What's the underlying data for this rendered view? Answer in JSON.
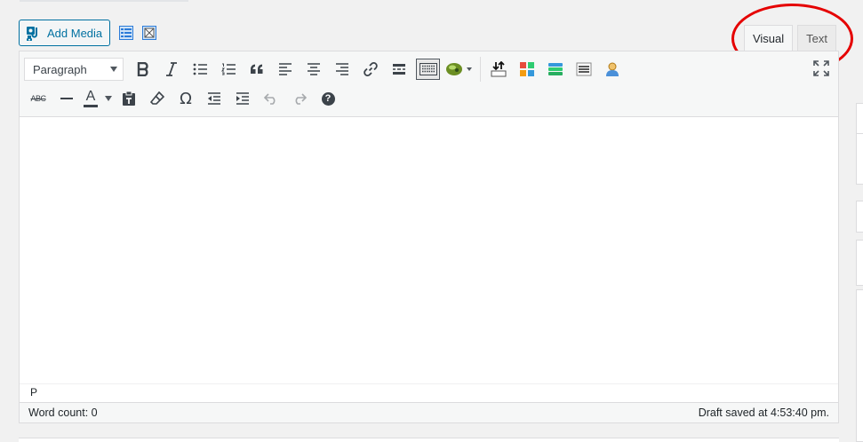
{
  "media": {
    "add_media_label": "Add Media",
    "extra_buttons": [
      "layout-icon",
      "image-placeholder-icon"
    ]
  },
  "tabs": {
    "visual_label": "Visual",
    "text_label": "Text",
    "active": "Visual"
  },
  "annotation": {
    "color": "#e50000"
  },
  "toolbar": {
    "format_select_value": "Paragraph",
    "row1": [
      "bold-icon",
      "italic-icon",
      "bulleted-list-icon",
      "numbered-list-icon",
      "blockquote-icon",
      "align-left-icon",
      "align-center-icon",
      "align-right-icon",
      "link-icon",
      "read-more-icon",
      "toolbar-toggle-icon",
      "plugin-lime-icon",
      "download-icon",
      "colored-blocks-icon",
      "stacked-bars-icon",
      "lines-icon",
      "user-icon",
      "fullscreen-icon"
    ],
    "row2": [
      "strikethrough-icon",
      "horizontal-line-icon",
      "text-color-icon",
      "paste-as-text-icon",
      "clear-formatting-icon",
      "special-character-icon",
      "outdent-icon",
      "indent-icon",
      "undo-icon",
      "redo-icon",
      "help-icon"
    ],
    "strikethrough_text": "ABC",
    "text_color_letter": "A",
    "omega": "Ω",
    "help_mark": "?"
  },
  "editor": {
    "path": "P",
    "word_count_label": "Word count: 0",
    "draft_status": "Draft saved at 4:53:40 pm."
  },
  "colors": {
    "accent": "#0071a1",
    "toolbar_bg": "#f6f7f7",
    "border": "#dcdcde"
  }
}
